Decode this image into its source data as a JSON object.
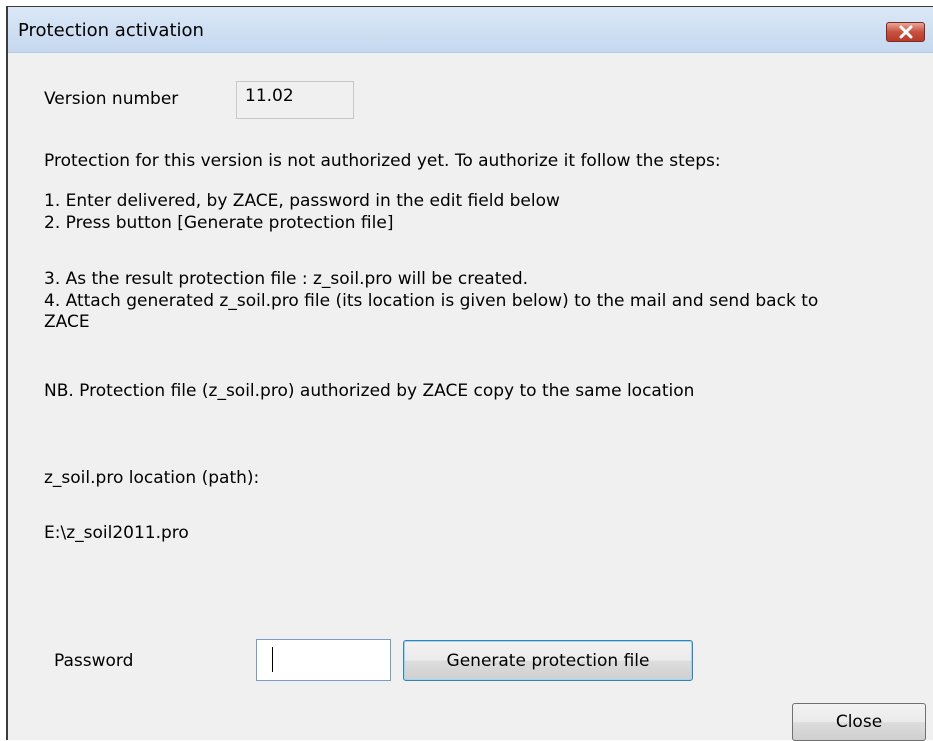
{
  "window": {
    "title": "Protection activation",
    "close_icon": "close-icon"
  },
  "version": {
    "label": "Version number",
    "value": "11.02"
  },
  "instructions": {
    "intro": "Protection for this version is not authorized yet. To authorize it follow the steps:",
    "step1": "1. Enter delivered, by ZACE, password in the edit field below",
    "step2": "2. Press button [Generate protection file]",
    "step3": "3. As the result protection file : z_soil.pro will be created.",
    "step4_line1": "4. Attach generated z_soil.pro file (its location is given below) to the mail and send back to",
    "step4_line2": "ZACE",
    "nb": "NB.  Protection file (z_soil.pro) authorized by ZACE copy to the same location"
  },
  "location": {
    "label": "z_soil.pro location (path):",
    "path": "E:\\z_soil2011.pro"
  },
  "password": {
    "label": "Password",
    "value": ""
  },
  "buttons": {
    "generate": "Generate protection file",
    "close": "Close"
  },
  "colors": {
    "dialog_bg": "#f0f0f0",
    "titlebar": "#c5d8ef",
    "close_red": "#c75140",
    "default_button_border": "#3c7fb1"
  }
}
